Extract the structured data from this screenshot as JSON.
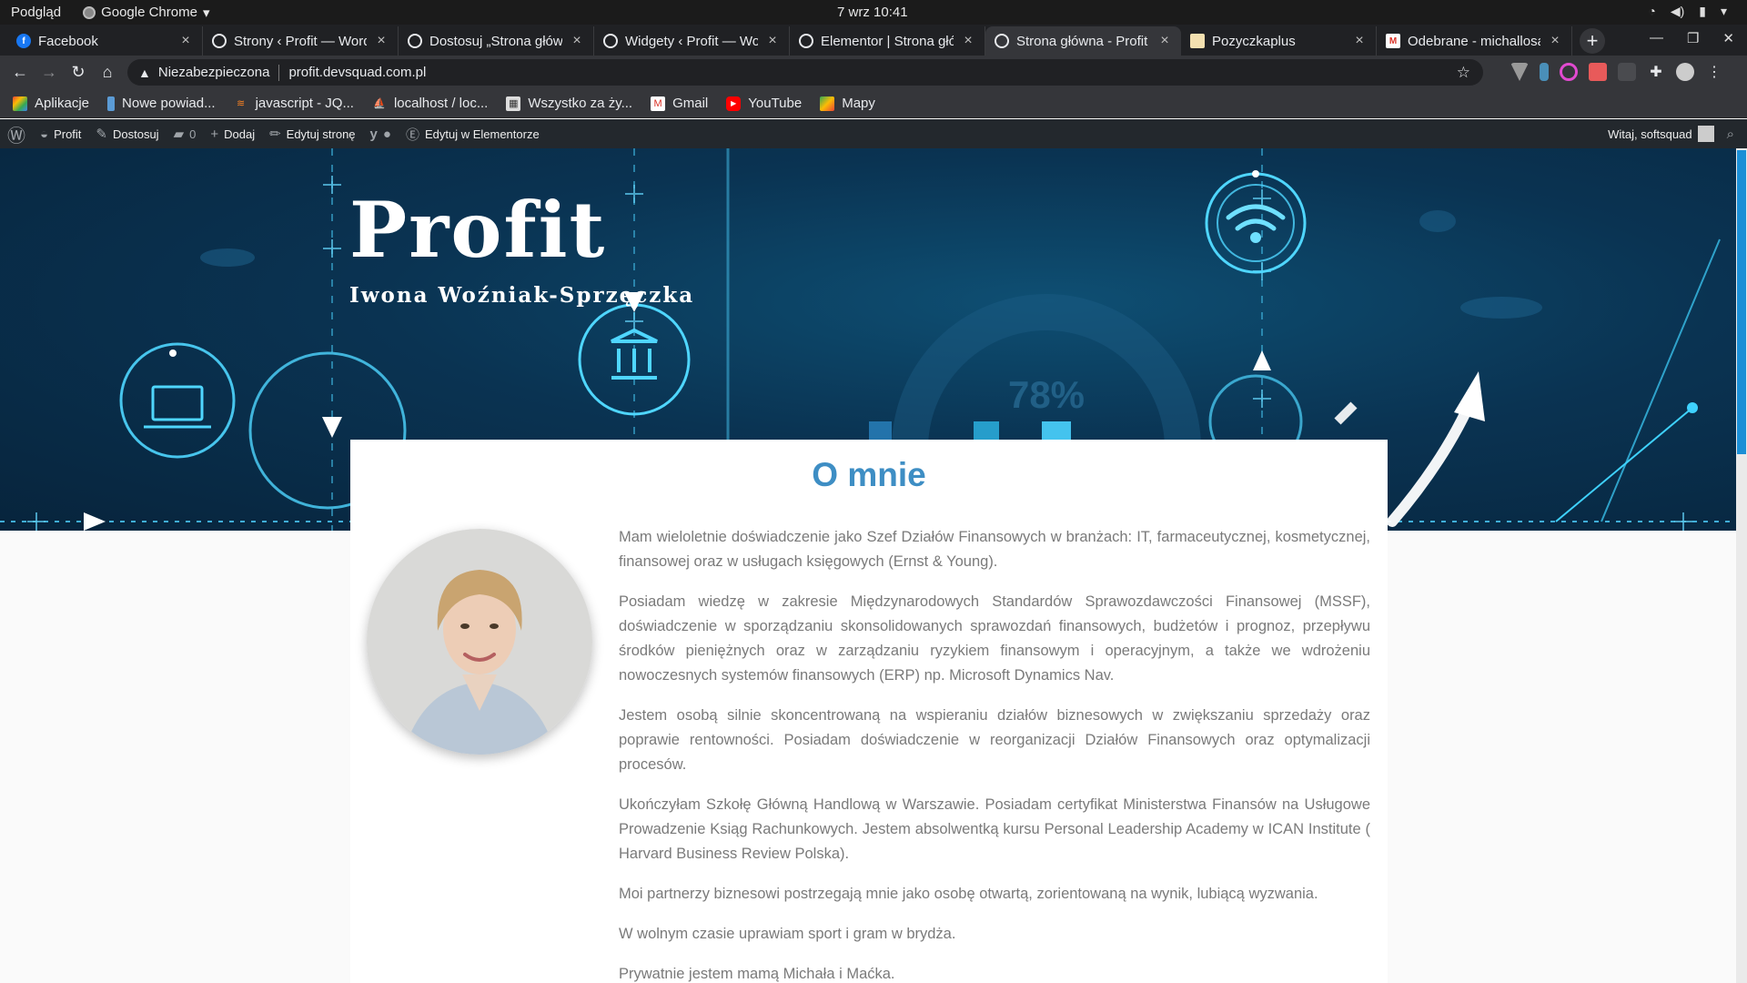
{
  "os": {
    "preview_label": "Podgląd",
    "app_name": "Google Chrome",
    "clock": "7 wrz  10:41"
  },
  "browser": {
    "tabs": [
      {
        "title": "Facebook",
        "icon": "facebook-icon",
        "active": false
      },
      {
        "title": "Strony ‹ Profit — Word",
        "icon": "globe-icon",
        "active": false
      },
      {
        "title": "Dostosuj „Strona głów",
        "icon": "globe-icon",
        "active": false
      },
      {
        "title": "Widgety ‹ Profit — Wo",
        "icon": "globe-icon",
        "active": false
      },
      {
        "title": "Elementor | Strona głó",
        "icon": "globe-icon",
        "active": false
      },
      {
        "title": "Strona główna - Profit",
        "icon": "globe-icon",
        "active": true
      },
      {
        "title": "Pozyczkaplus",
        "icon": "page-icon",
        "active": false
      },
      {
        "title": "Odebrane - michallosa",
        "icon": "gmail-icon",
        "active": false
      }
    ],
    "security_label": "Niezabezpieczona",
    "url": "profit.devsquad.com.pl",
    "bookmarks": [
      {
        "label": "Aplikacje",
        "icon": "apps-grid-icon"
      },
      {
        "label": "Nowe powiad...",
        "icon": "bookmark-icon"
      },
      {
        "label": "javascript - JQ...",
        "icon": "stackoverflow-icon"
      },
      {
        "label": "localhost / loc...",
        "icon": "phpmyadmin-icon"
      },
      {
        "label": "Wszystko za ży...",
        "icon": "store-icon"
      },
      {
        "label": "Gmail",
        "icon": "gmail-icon"
      },
      {
        "label": "YouTube",
        "icon": "youtube-icon"
      },
      {
        "label": "Mapy",
        "icon": "maps-icon"
      }
    ]
  },
  "wp_admin_bar": {
    "site_name": "Profit",
    "customize": "Dostosuj",
    "comments_count": "0",
    "add_new": "Dodaj",
    "edit_page": "Edytuj stronę",
    "edit_elementor": "Edytuj w Elementorze",
    "greeting": "Witaj, softsquad"
  },
  "hero": {
    "site_title": "Profit",
    "tagline": "Iwona Woźniak-Sprzęczka",
    "chart_percent": "78%"
  },
  "about": {
    "heading": "O mnie",
    "paragraphs": [
      "Mam wieloletnie doświadczenie jako Szef Działów Finansowych w branżach: IT, farmaceutycznej, kosmetycznej, finansowej oraz w usługach księgowych (Ernst & Young).",
      "Posiadam wiedzę w zakresie Międzynarodowych Standardów Sprawozdawczości Finansowej (MSSF), doświadczenie w sporządzaniu skonsolidowanych sprawozdań finansowych, budżetów i prognoz, przepływu środków pieniężnych oraz w zarządzaniu ryzykiem finansowym i operacyjnym, a także we wdrożeniu nowoczesnych systemów finansowych (ERP) np. Microsoft Dynamics Nav.",
      "Jestem osobą silnie skoncentrowaną na wspieraniu działów biznesowych w zwiększaniu sprzedaży oraz poprawie rentowności. Posiadam doświadczenie w reorganizacji Działów Finansowych oraz optymalizacji procesów.",
      "Ukończyłam Szkołę Główną Handlową w Warszawie. Posiadam certyfikat Ministerstwa Finansów na Usługowe Prowadzenie Ksiąg Rachunkowych. Jestem absolwentką kursu Personal Leadership Academy w ICAN Institute ( Harvard Business Review Polska).",
      "Moi partnerzy biznesowi postrzegają mnie jako osobę otwartą, zorientowaną na wynik, lubiącą wyzwania.",
      "W wolnym czasie uprawiam sport i gram w brydża.",
      "Prywatnie jestem mamą Michała i Maćka."
    ]
  },
  "colors": {
    "accent_heading": "#3e8ec4",
    "hero_dark": "#07243c",
    "hero_glow": "#3fd2ff",
    "scroll_thumb": "#1b8fd6"
  }
}
